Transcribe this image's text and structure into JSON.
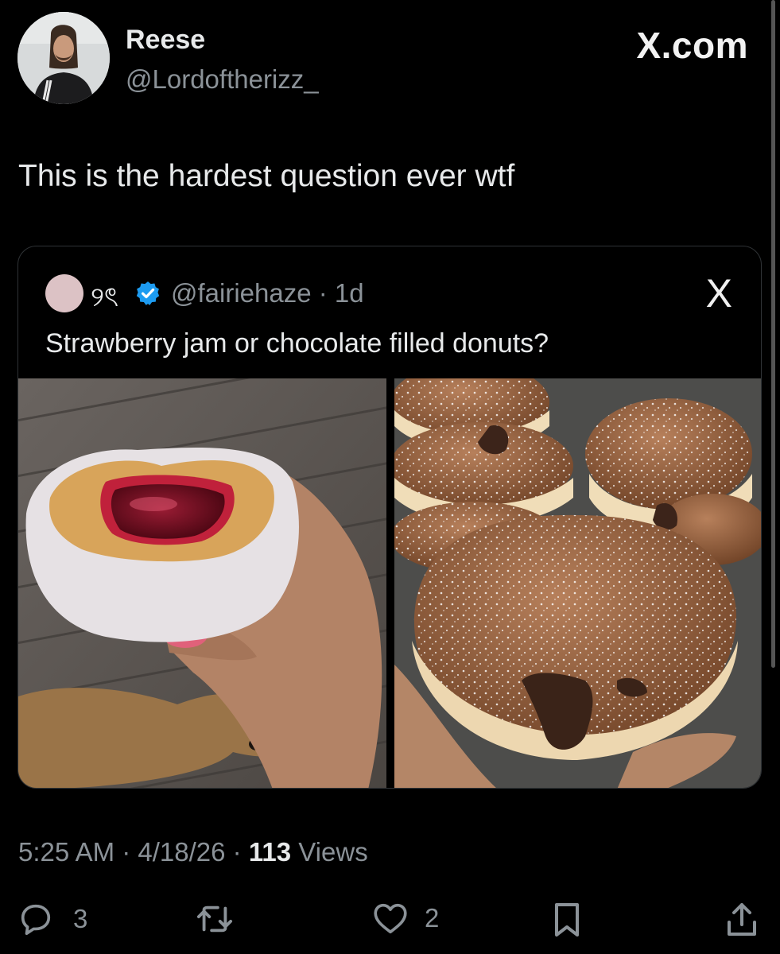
{
  "author": {
    "display_name": "Reese",
    "handle": "@Lordoftherizz_",
    "avatar_icon": "profile-photo"
  },
  "watermark": "X.com",
  "tweet_text": "This is the hardest question ever wtf",
  "quoted": {
    "name": "୨ৎ",
    "verified_icon": "verified-badge-icon",
    "handle_time": "@fairiehaze · 1d",
    "text": "Strawberry jam or chocolate filled donuts?",
    "x_logo": "X",
    "images": [
      "strawberry-jam-donut-photo",
      "chocolate-filled-donuts-photo"
    ]
  },
  "meta": {
    "time_date": "5:25 AM · 4/18/26 · ",
    "views_count": "113",
    "views_label": " Views"
  },
  "actions": {
    "replies": "3",
    "reposts": "",
    "likes": "2"
  },
  "colors": {
    "background": "#000000",
    "text": "#e7e9ea",
    "muted": "#8b9298",
    "verified": "#1d9bf0"
  }
}
